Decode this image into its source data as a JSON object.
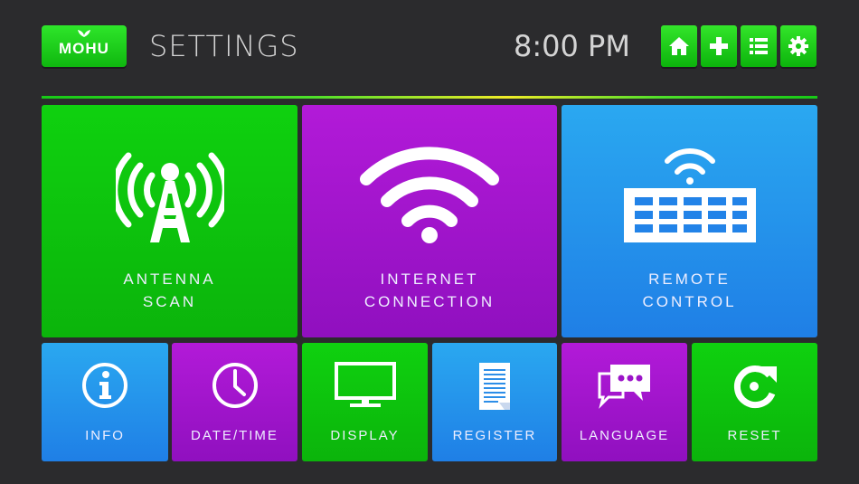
{
  "header": {
    "logo_text": "MOHU",
    "title": "SETTINGS",
    "time": "8:00 PM",
    "icons": [
      "home-icon",
      "plus-icon",
      "list-icon",
      "gear-icon"
    ]
  },
  "tiles": {
    "antenna_scan": {
      "label_line1": "ANTENNA",
      "label_line2": "SCAN",
      "icon": "antenna-tower-icon"
    },
    "internet_connection": {
      "label_line1": "INTERNET",
      "label_line2": "CONNECTION",
      "icon": "wifi-icon"
    },
    "remote_control": {
      "label_line1": "REMOTE",
      "label_line2": "CONTROL",
      "icon": "wireless-keyboard-icon"
    },
    "info": {
      "label": "INFO",
      "icon": "info-icon"
    },
    "date_time": {
      "label": "DATE/TIME",
      "icon": "clock-icon"
    },
    "display": {
      "label": "DISPLAY",
      "icon": "monitor-icon"
    },
    "register": {
      "label": "REGISTER",
      "icon": "document-icon"
    },
    "language": {
      "label": "LANGUAGE",
      "icon": "chat-bubbles-icon"
    },
    "reset": {
      "label": "RESET",
      "icon": "reset-icon"
    }
  },
  "colors": {
    "background": "#2b2b2d",
    "green": "#0bc40b",
    "purple": "#a116cc",
    "blue": "#2596ec",
    "text_light": "#d4d4d4"
  }
}
